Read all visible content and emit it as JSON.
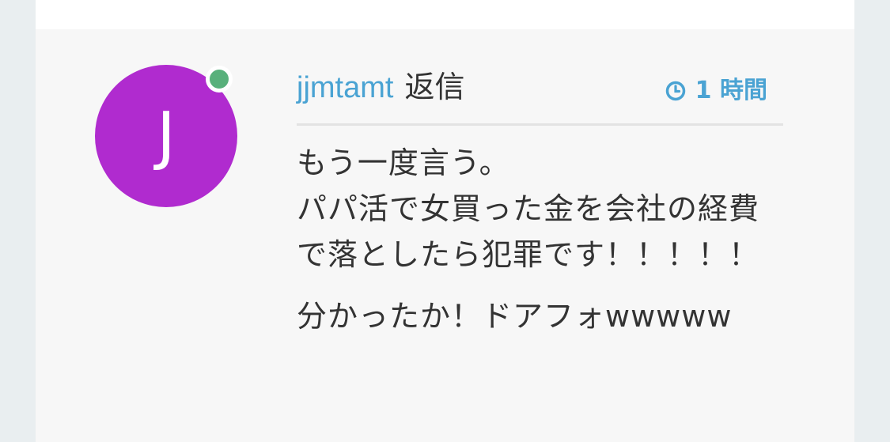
{
  "colors": {
    "avatar_bg": "#b02bcf",
    "online": "#58b07b",
    "link": "#4aa3d3"
  },
  "comment": {
    "avatar_letter": "J",
    "author": "jjmtamt",
    "reply_label": "返信",
    "time_icon": "clock-icon",
    "time": "1 時間",
    "paragraphs": [
      "もう一度言う。\nパパ活で女買った金を会社の経費で落としたら犯罪です！！！！！",
      "分かったか！ドアフォwwwww"
    ]
  }
}
